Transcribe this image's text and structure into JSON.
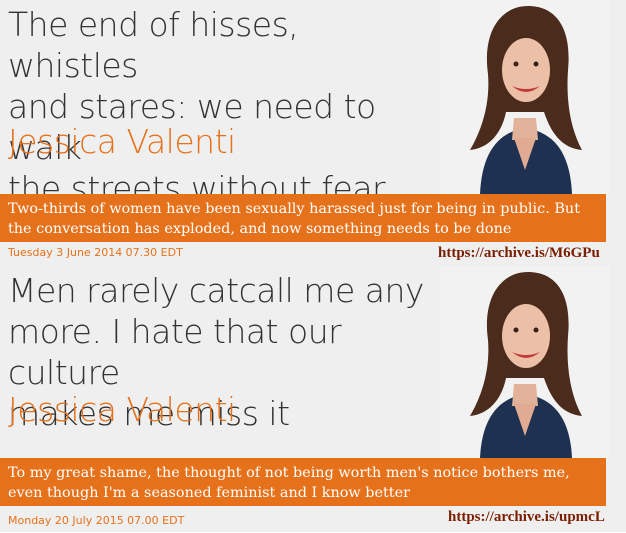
{
  "articles": [
    {
      "headline_lines": [
        "The end of hisses, whistles",
        "and stares: we need to walk",
        "the streets without fear"
      ],
      "author": "Jessica Valenti",
      "standfirst": "Two-thirds of women have been sexually harassed just for being in public. But the conversation has exploded, and now something needs to be done",
      "date": "Tuesday 3 June 2014 07.30 EDT",
      "archive_link": "https://archive.is/M6GPu"
    },
    {
      "headline_lines": [
        "Men rarely catcall me any",
        "more. I hate that our culture",
        "makes me miss it"
      ],
      "author": "Jessica Valenti",
      "standfirst": "To my great shame, the thought of not being worth men's notice bothers me, even though I'm a seasoned feminist and I know better",
      "date": "Monday 20 July 2015 07.00 EDT",
      "archive_link": "https://archive.is/upmcL"
    }
  ],
  "colors": {
    "accent": "#e6711b",
    "panel_bg": "#efefef",
    "headline": "#333333",
    "link": "#7a1e00"
  }
}
